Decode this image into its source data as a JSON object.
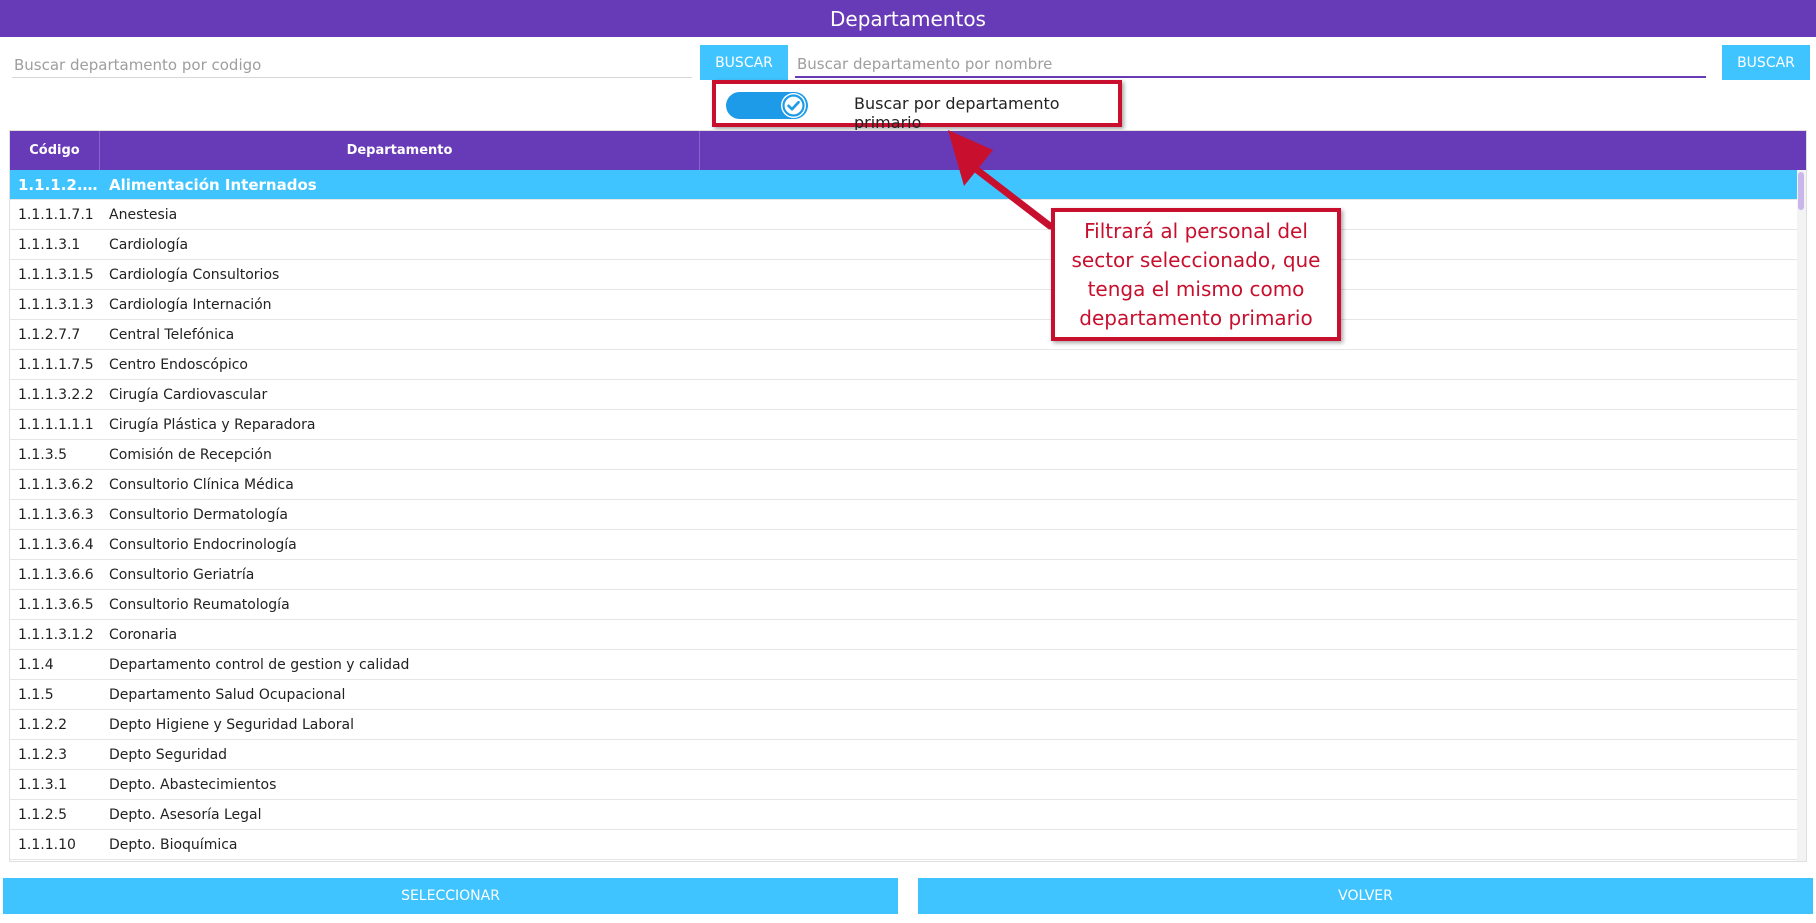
{
  "window": {
    "title": "Departamentos"
  },
  "search": {
    "code_placeholder": "Buscar departamento por codigo",
    "code_button": "BUSCAR",
    "name_placeholder": "Buscar departamento por nombre",
    "name_button": "BUSCAR"
  },
  "toggle": {
    "label": "Buscar por departamento primario",
    "checked": true,
    "icon": "check-icon"
  },
  "table": {
    "headers": {
      "code": "Código",
      "department": "Departamento"
    },
    "rows": [
      {
        "code": "1.1.1.2.…",
        "name": "Alimentación Internados",
        "selected": true
      },
      {
        "code": "1.1.1.1.7.1",
        "name": "Anestesia"
      },
      {
        "code": "1.1.1.3.1",
        "name": "Cardiología"
      },
      {
        "code": "1.1.1.3.1.5",
        "name": "Cardiología Consultorios"
      },
      {
        "code": "1.1.1.3.1.3",
        "name": "Cardiología Internación"
      },
      {
        "code": "1.1.2.7.7",
        "name": "Central Telefónica"
      },
      {
        "code": "1.1.1.1.7.5",
        "name": "Centro Endoscópico"
      },
      {
        "code": "1.1.1.3.2.2",
        "name": "Cirugía Cardiovascular"
      },
      {
        "code": "1.1.1.1.1.1",
        "name": "Cirugía Plástica y Reparadora"
      },
      {
        "code": "1.1.3.5",
        "name": "Comisión de Recepción"
      },
      {
        "code": "1.1.1.3.6.2",
        "name": "Consultorio Clínica Médica"
      },
      {
        "code": "1.1.1.3.6.3",
        "name": "Consultorio Dermatología"
      },
      {
        "code": "1.1.1.3.6.4",
        "name": "Consultorio Endocrinología"
      },
      {
        "code": "1.1.1.3.6.6",
        "name": "Consultorio Geriatría"
      },
      {
        "code": "1.1.1.3.6.5",
        "name": "Consultorio Reumatología"
      },
      {
        "code": "1.1.1.3.1.2",
        "name": "Coronaria"
      },
      {
        "code": "1.1.4",
        "name": "Departamento control de gestion y calidad"
      },
      {
        "code": "1.1.5",
        "name": "Departamento Salud Ocupacional"
      },
      {
        "code": "1.1.2.2",
        "name": "Depto Higiene y Seguridad Laboral"
      },
      {
        "code": "1.1.2.3",
        "name": "Depto Seguridad"
      },
      {
        "code": "1.1.3.1",
        "name": "Depto. Abastecimientos"
      },
      {
        "code": "1.1.2.5",
        "name": "Depto. Asesoría Legal"
      },
      {
        "code": "1.1.1.10",
        "name": "Depto. Bioquímica"
      }
    ]
  },
  "footer": {
    "select_button": "SELECCIONAR",
    "back_button": "VOLVER"
  },
  "annotation": {
    "text": "Filtrará al personal del sector seleccionado, que tenga el mismo como departamento primario",
    "color": "#c8102e"
  },
  "colors": {
    "primary": "#673ab7",
    "accent": "#40c4ff",
    "toggle": "#1e9be8"
  }
}
